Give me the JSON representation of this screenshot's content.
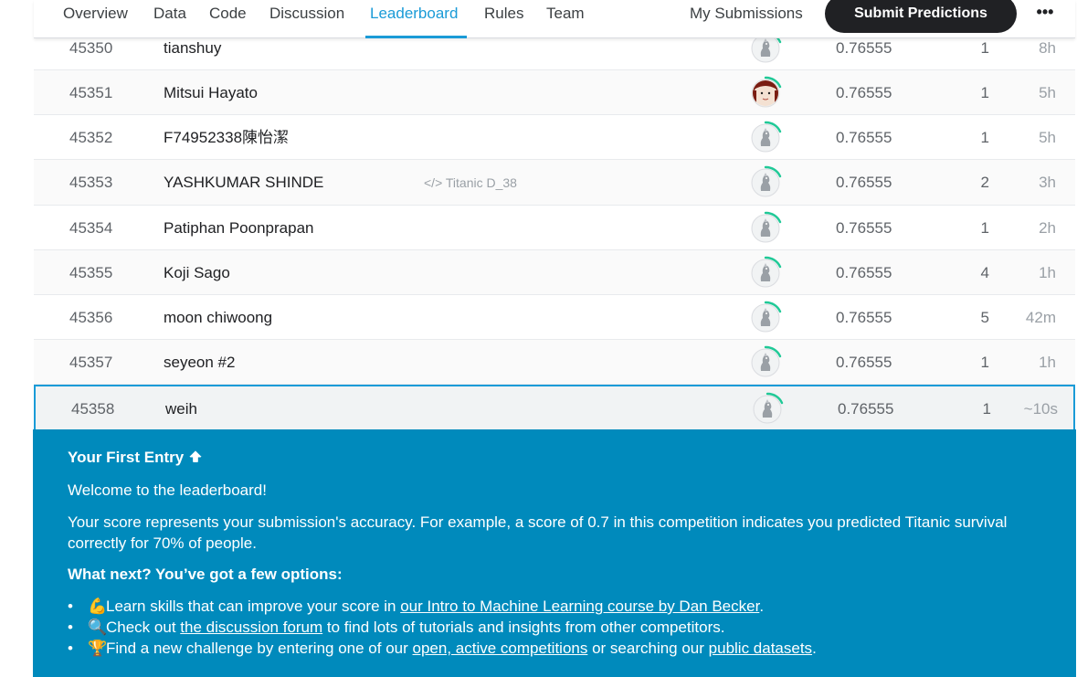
{
  "nav": {
    "tabs": [
      "Overview",
      "Data",
      "Code",
      "Discussion",
      "Leaderboard",
      "Rules",
      "Team"
    ],
    "active_tab": "Leaderboard",
    "my_submissions": "My Submissions",
    "submit_label": "Submit Predictions",
    "more_label": "•••"
  },
  "leaderboard": {
    "rows": [
      {
        "rank": "45350",
        "team": "tianshuy",
        "notebook": "",
        "score": "0.76555",
        "entries": "1",
        "last": "8h",
        "avatar": "default"
      },
      {
        "rank": "45351",
        "team": "Mitsui Hayato",
        "notebook": "",
        "score": "0.76555",
        "entries": "1",
        "last": "5h",
        "avatar": "photo"
      },
      {
        "rank": "45352",
        "team": "F74952338陳怡潔",
        "notebook": "",
        "score": "0.76555",
        "entries": "1",
        "last": "5h",
        "avatar": "default"
      },
      {
        "rank": "45353",
        "team": "YASHKUMAR SHINDE",
        "notebook": "</> Titanic D_38",
        "score": "0.76555",
        "entries": "2",
        "last": "3h",
        "avatar": "default"
      },
      {
        "rank": "45354",
        "team": "Patiphan Poonprapan",
        "notebook": "",
        "score": "0.76555",
        "entries": "1",
        "last": "2h",
        "avatar": "default"
      },
      {
        "rank": "45355",
        "team": "Koji Sago",
        "notebook": "",
        "score": "0.76555",
        "entries": "4",
        "last": "1h",
        "avatar": "default"
      },
      {
        "rank": "45356",
        "team": "moon chiwoong",
        "notebook": "",
        "score": "0.76555",
        "entries": "5",
        "last": "42m",
        "avatar": "default"
      },
      {
        "rank": "45357",
        "team": "seyeon #2",
        "notebook": "",
        "score": "0.76555",
        "entries": "1",
        "last": "1h",
        "avatar": "default"
      },
      {
        "rank": "45358",
        "team": "weih",
        "notebook": "",
        "score": "0.76555",
        "entries": "1",
        "last": "~10s",
        "avatar": "default"
      }
    ]
  },
  "banner": {
    "title": "Your First Entry",
    "welcome": "Welcome to the leaderboard!",
    "score_explainer": "Your score represents your submission's accuracy. For example, a score of 0.7 in this competition indicates you predicted Titanic survival correctly for 70% of people.",
    "next_heading": "What next? You’ve got a few options:",
    "options": [
      {
        "emoji": "💪",
        "before": "Learn skills that can improve your score in ",
        "link": "our Intro to Machine Learning course by Dan Becker",
        "after": "."
      },
      {
        "emoji": "🔍",
        "before": "Check out ",
        "link": "the discussion forum",
        "after": " to find lots of tutorials and insights from other competitors."
      },
      {
        "emoji": "🏆",
        "before": "Find a new challenge by entering one of our ",
        "link": "open, active competitions",
        "after": " or searching our ",
        "link2": "public datasets",
        "after2": "."
      }
    ]
  },
  "colors": {
    "accent": "#1a9bd7",
    "banner_bg": "#008abc",
    "tier_ring": "#20c997"
  }
}
